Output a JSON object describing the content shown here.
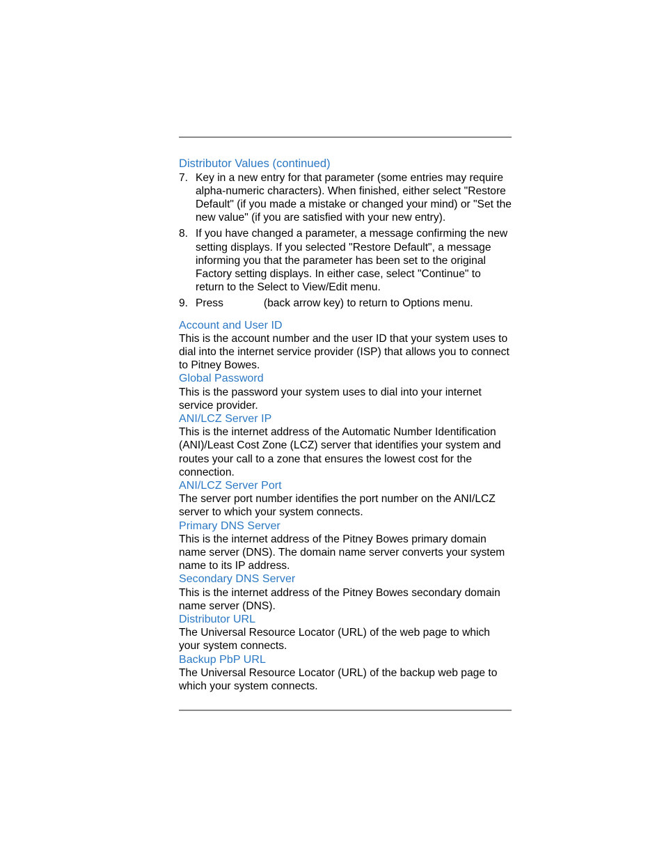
{
  "page": {
    "background_color": "#ffffff",
    "heading_color": "#2b78c4",
    "body_color": "#000000",
    "rule_color": "#8a8a8a"
  },
  "section_title": "Distributor Values (continued)",
  "numbered_steps": [
    {
      "number": "7.",
      "text": "Key in a new entry for that parameter (some entries may require alpha-numeric characters). When finished, either select \"Restore Default\" (if you made a mistake or changed your mind) or \"Set the new value\" (if you are satisfied with your new entry)."
    },
    {
      "number": "8.",
      "text": "If you have changed a parameter, a message confirming the new setting displays. If you selected \"Restore Default\", a message informing you that the parameter has been set to the original Factory setting displays. In either case, select \"Continue\" to return to the Select to View/Edit menu."
    },
    {
      "number": "9.",
      "text_before_graphic": "Press",
      "graphic": "back-arrow-key-icon",
      "text_after_graphic": "(back arrow key) to return to Options menu."
    }
  ],
  "definitions": [
    {
      "heading": "Account and User ID",
      "body": "This is the account number and the user ID that your system uses to dial into the internet service provider (ISP) that allows you to connect to Pitney Bowes."
    },
    {
      "heading": "Global Password",
      "body": "This is the password your system uses to dial into your internet service provider."
    },
    {
      "heading": "ANI/LCZ Server IP",
      "body": "This is the internet address of the Automatic Number Identification (ANI)/Least Cost Zone (LCZ) server that identifies your system and routes your call to a zone that ensures the lowest cost for the connection."
    },
    {
      "heading": "ANI/LCZ Server Port",
      "body": "The server port number identifies the port number on the ANI/LCZ server to which your system connects."
    },
    {
      "heading": "Primary DNS Server",
      "body": "This is the internet address of the Pitney Bowes primary domain name server (DNS). The domain name server converts your system name to its IP address."
    },
    {
      "heading": "Secondary DNS Server",
      "body": "This is the internet address of the Pitney Bowes secondary domain name server (DNS)."
    },
    {
      "heading": "Distributor URL",
      "body": "The Universal Resource Locator (URL) of the web page to which your system connects."
    },
    {
      "heading": "Backup PbP URL",
      "body": "The Universal Resource Locator (URL) of the backup web page to which your system connects."
    }
  ]
}
